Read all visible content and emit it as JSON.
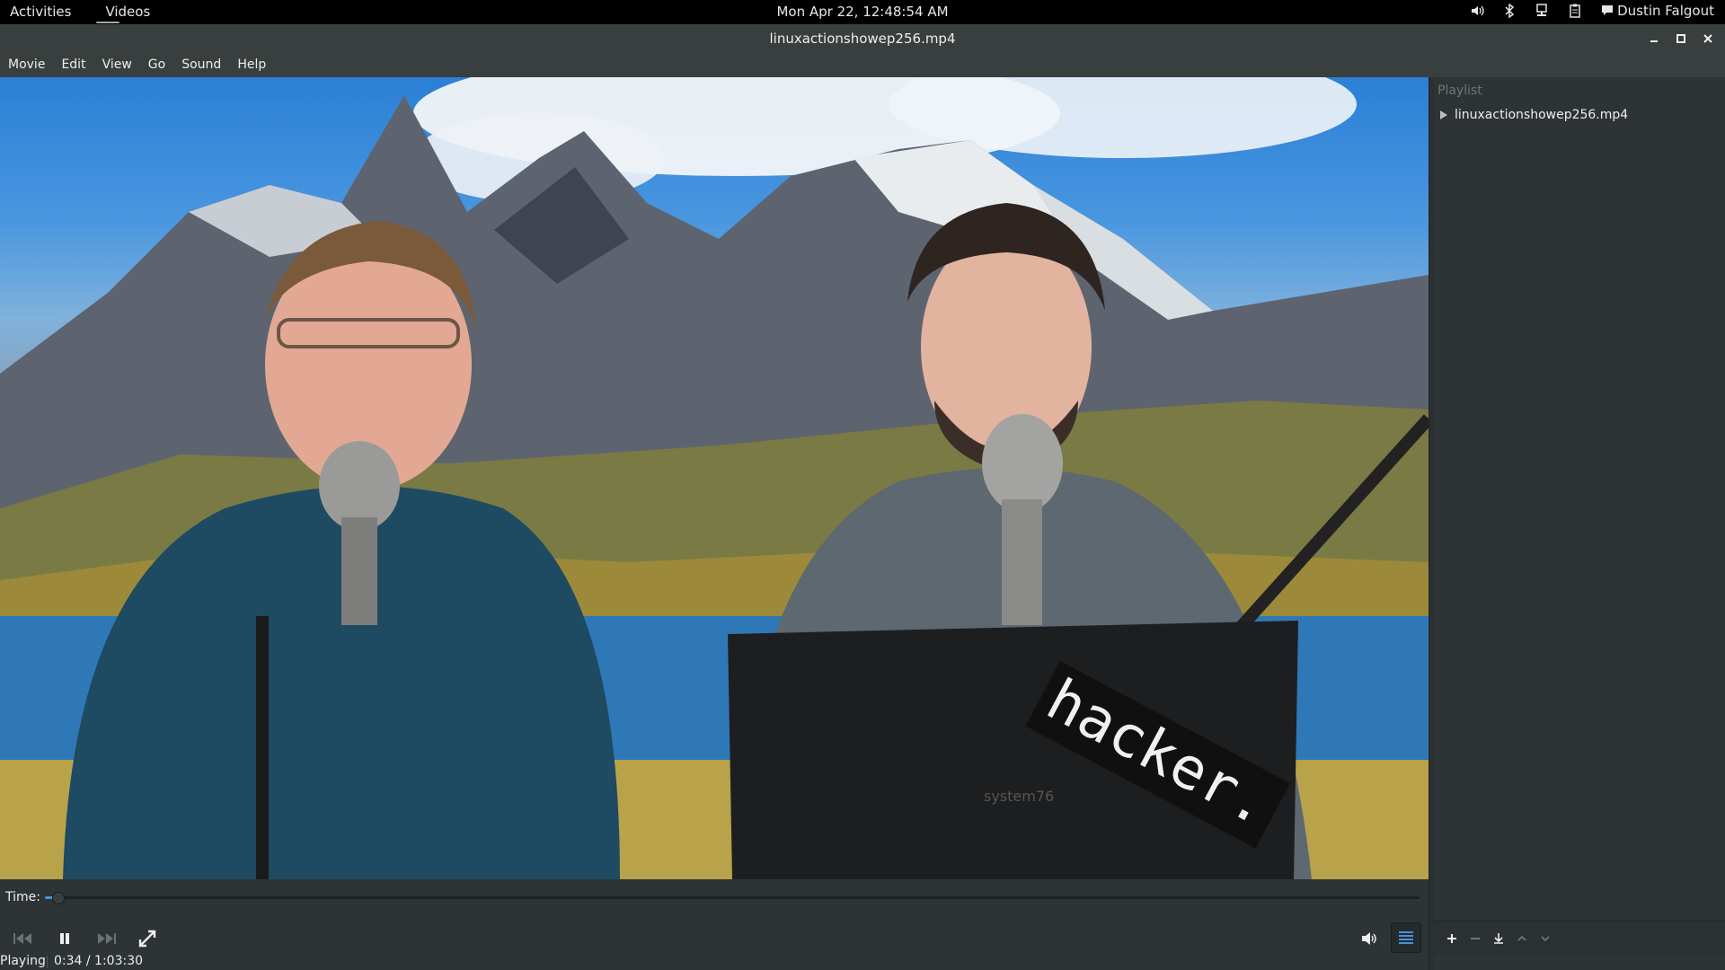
{
  "topbar": {
    "activities": "Activities",
    "app_name": "Videos",
    "clock": "Mon Apr 22, 12:48:54 AM",
    "user": "Dustin Falgout",
    "icons": [
      "volume-icon",
      "bluetooth-icon",
      "network-icon",
      "clipboard-icon",
      "chat-icon"
    ]
  },
  "window": {
    "title": "linuxactionshowep256.mp4"
  },
  "menu": {
    "items": [
      "Movie",
      "Edit",
      "View",
      "Go",
      "Sound",
      "Help"
    ]
  },
  "video": {
    "overlay_text": "hacker.",
    "laptop_brand": "system76"
  },
  "playlist": {
    "header": "Playlist",
    "items": [
      {
        "name": "linuxactionshowep256.mp4",
        "playing": true
      }
    ],
    "toolbar_icons": [
      "add-icon",
      "remove-icon",
      "save-icon",
      "move-up-icon",
      "move-down-icon"
    ]
  },
  "controls": {
    "time_label": "Time:",
    "progress_fraction": 0.009,
    "buttons": [
      "previous-icon",
      "pause-icon",
      "next-icon",
      "fullscreen-icon",
      "volume-icon",
      "playlist-toggle-icon"
    ]
  },
  "status": {
    "state": "Playing",
    "time": "0:34 / 1:03:30"
  },
  "colors": {
    "accent": "#4a90d9",
    "background": "#2e3436",
    "topbar": "#000000"
  }
}
